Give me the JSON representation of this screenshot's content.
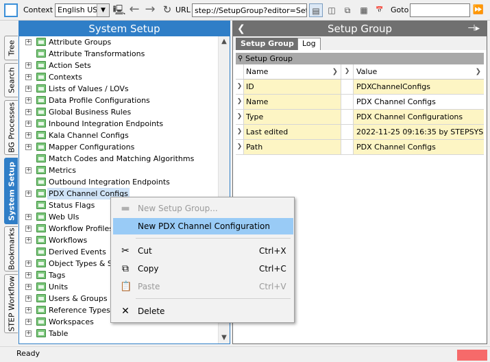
{
  "toolbar": {
    "context_label": "Context",
    "context_value": "English US",
    "url_label": "URL",
    "url_value": "step://SetupGroup?editor=SetupG",
    "goto_label": "Goto",
    "goto_value": ""
  },
  "vtabs": [
    {
      "label": "Tree",
      "active": false
    },
    {
      "label": "Search",
      "active": false
    },
    {
      "label": "BG Processes",
      "active": false
    },
    {
      "label": "System Setup",
      "active": true
    },
    {
      "label": "Bookmarks",
      "active": false
    },
    {
      "label": "STEP Workflow",
      "active": false
    }
  ],
  "left_panel": {
    "title": "System Setup",
    "tree": [
      {
        "label": "Attribute Groups",
        "expander": true,
        "icon": "folder-icon"
      },
      {
        "label": "Attribute Transformations",
        "expander": false,
        "icon": "folder-icon"
      },
      {
        "label": "Action Sets",
        "expander": true,
        "icon": "folder-icon"
      },
      {
        "label": "Contexts",
        "expander": true,
        "icon": "context-icon"
      },
      {
        "label": "Lists of Values / LOVs",
        "expander": true,
        "icon": "folder-icon"
      },
      {
        "label": "Data Profile Configurations",
        "expander": true,
        "icon": "folder-icon"
      },
      {
        "label": "Global Business Rules",
        "expander": true,
        "icon": "folder-icon"
      },
      {
        "label": "Inbound Integration Endpoints",
        "expander": true,
        "icon": "folder-icon"
      },
      {
        "label": "Kala Channel Configs",
        "expander": true,
        "icon": "folder-icon"
      },
      {
        "label": "Mapper Configurations",
        "expander": true,
        "icon": "folder-icon"
      },
      {
        "label": "Match Codes and Matching Algorithms",
        "expander": false,
        "icon": "folder-icon"
      },
      {
        "label": "Metrics",
        "expander": true,
        "icon": "folder-icon"
      },
      {
        "label": "Outbound Integration Endpoints",
        "expander": false,
        "icon": "folder-icon"
      },
      {
        "label": "PDX Channel Configs",
        "expander": true,
        "icon": "folder-icon",
        "selected": true
      },
      {
        "label": "Status Flags",
        "expander": false,
        "icon": "folder-icon"
      },
      {
        "label": "Web UIs",
        "expander": true,
        "icon": "folder-icon"
      },
      {
        "label": "Workflow Profiles",
        "expander": true,
        "icon": "folder-icon"
      },
      {
        "label": "Workflows",
        "expander": true,
        "icon": "folder-icon"
      },
      {
        "label": "Derived Events",
        "expander": false,
        "icon": "document-icon"
      },
      {
        "label": "Object Types & Str",
        "expander": true,
        "icon": "folder-icon"
      },
      {
        "label": "Tags",
        "expander": true,
        "icon": "folder-icon"
      },
      {
        "label": "Units",
        "expander": true,
        "icon": "ruler-icon"
      },
      {
        "label": "Users & Groups",
        "expander": true,
        "icon": "users-icon"
      },
      {
        "label": "Reference Types",
        "expander": true,
        "icon": "reference-icon"
      },
      {
        "label": "Workspaces",
        "expander": true,
        "icon": "folder-icon"
      },
      {
        "label": "Table",
        "expander": true,
        "icon": "table-icon"
      }
    ]
  },
  "right_panel": {
    "title": "Setup Group",
    "tabs": [
      {
        "label": "Setup Group",
        "active": true
      },
      {
        "label": "Log",
        "active": false
      }
    ],
    "section_title": "Setup Group",
    "grid_headers": {
      "name": "Name",
      "value": "Value"
    },
    "rows": [
      {
        "name": "ID",
        "value": "PDXChannelConfigs"
      },
      {
        "name": "Name",
        "value": "PDX Channel Configs"
      },
      {
        "name": "Type",
        "value": "PDX Channel Configurations"
      },
      {
        "name": "Last edited",
        "value": "2022-11-25 09:16:35 by STEPSYS"
      },
      {
        "name": "Path",
        "value": "PDX Channel Configs"
      }
    ]
  },
  "context_menu": {
    "items": [
      {
        "label": "New Setup Group...",
        "disabled": true,
        "icon": "folder-icon"
      },
      {
        "label": "New PDX Channel Configuration",
        "highlighted": true
      },
      {
        "label": "Cut",
        "shortcut": "Ctrl+X",
        "icon": "cut-icon"
      },
      {
        "label": "Copy",
        "shortcut": "Ctrl+C",
        "icon": "copy-icon"
      },
      {
        "label": "Paste",
        "shortcut": "Ctrl+V",
        "disabled": true,
        "icon": "paste-icon"
      },
      {
        "label": "Delete",
        "icon": "delete-icon"
      }
    ]
  },
  "status": {
    "text": "Ready"
  },
  "colors": {
    "accent": "#2f7ec7",
    "grid_value_bg": "#fdf5c4",
    "menu_highlight": "#99cbf6",
    "warning": "#f66a6a"
  }
}
